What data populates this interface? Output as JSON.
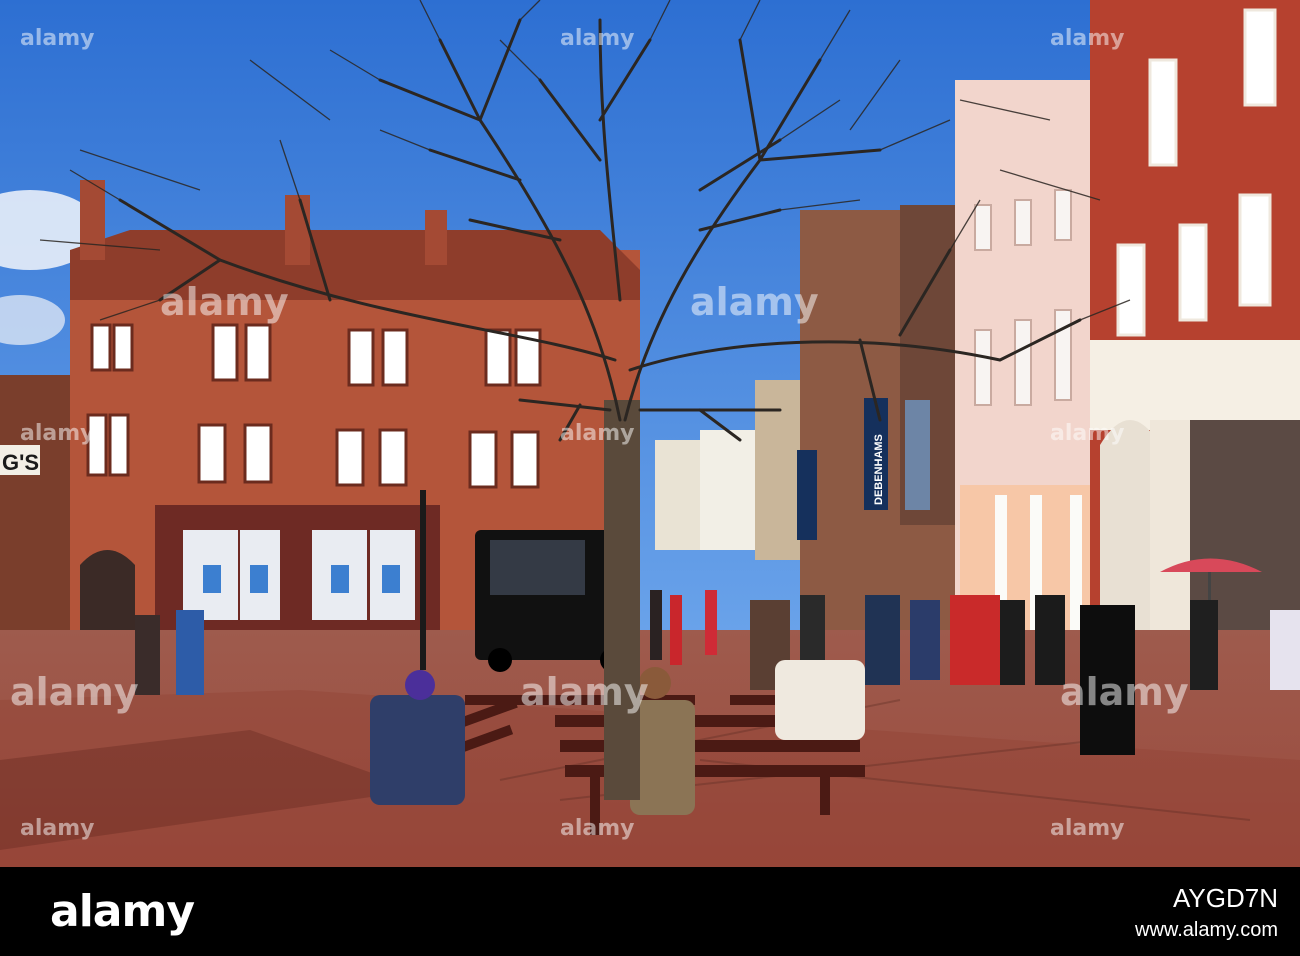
{
  "watermark": {
    "brand": "alamy",
    "grid_text": "alamy"
  },
  "footer": {
    "brand": "alamy",
    "image_code": "AYGD7N",
    "url": "www.alamy.com"
  },
  "scene_text": {
    "sign_debenhams": "DEBENHAMS",
    "sign_gs": "G'S"
  },
  "colors": {
    "sky": "#3a78d6",
    "brick": "#b4553a",
    "pavement": "#a9574a",
    "footer": "#000000"
  }
}
